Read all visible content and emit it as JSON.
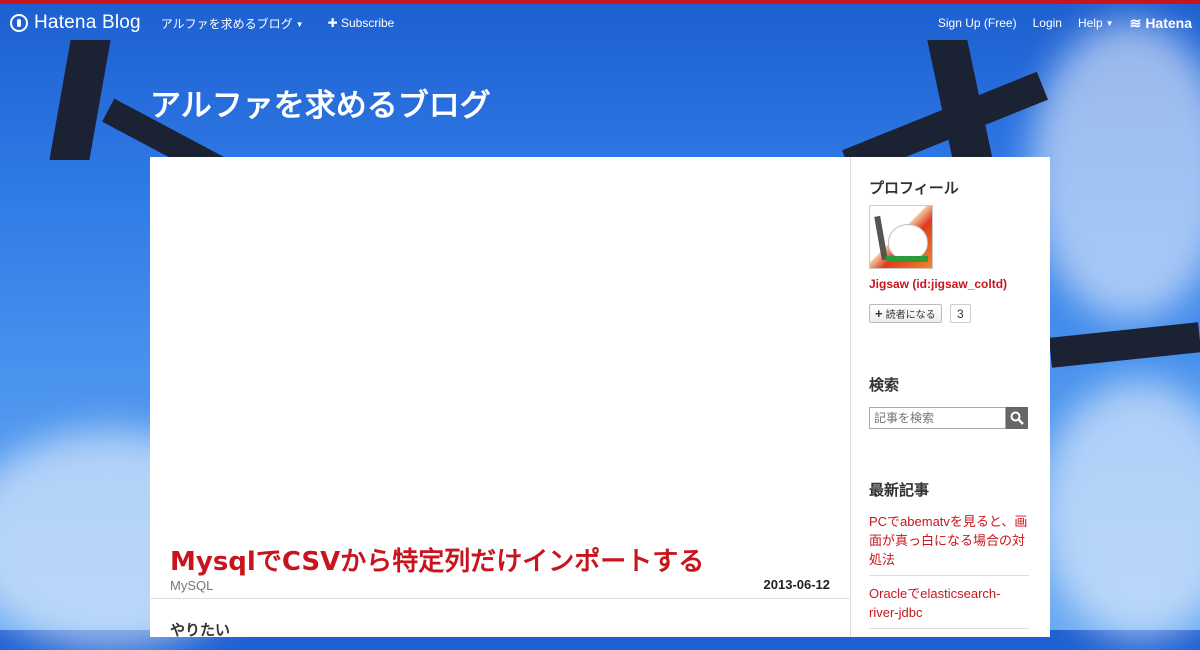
{
  "topbar": {
    "logo": "Hatena Blog",
    "blog_menu": "アルファを求めるブログ",
    "subscribe": "✚ Subscribe",
    "signup": "Sign Up (Free)",
    "login": "Login",
    "help": "Help",
    "hatena": "Hatena"
  },
  "blog": {
    "title": "アルファを求めるブログ"
  },
  "entry": {
    "title": "MysqlでCSVから特定列だけインポートする",
    "category": "MySQL",
    "date": "2013-06-12",
    "body_start": "やりたい"
  },
  "sidebar": {
    "profile_title": "プロフィール",
    "profile_name": "Jigsaw (id:jigsaw_coltd)",
    "subscribe_label": "読者になる",
    "subscribe_count": "3",
    "search_title": "検索",
    "search_placeholder": "記事を検索",
    "recent_title": "最新記事",
    "recent": [
      "PCでabematvを見ると、画面が真っ白になる場合の対処法",
      "Oracleでelasticsearch-river-jdbc"
    ]
  },
  "colors": {
    "accent": "#c8151d",
    "sky": "#2f7ae6"
  },
  "icons": [
    "hatena-drop-icon",
    "caret-down-icon",
    "plus-icon",
    "search-icon"
  ]
}
